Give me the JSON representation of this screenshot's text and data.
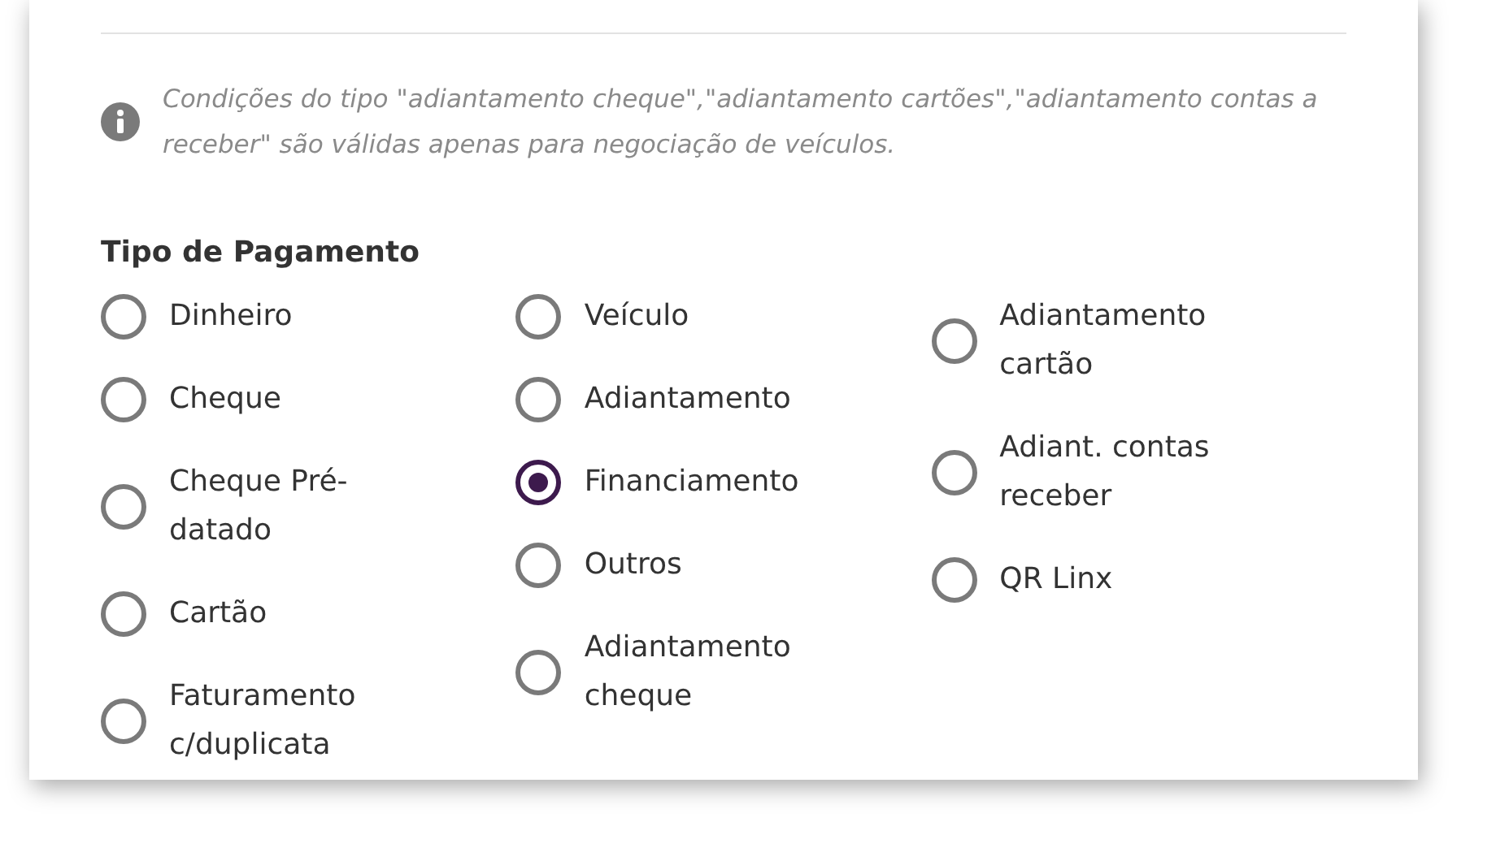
{
  "info": "Condições do tipo \"adiantamento cheque\",\"adiantamento cartões\",\"adiantamento contas a receber\" são válidas apenas para negociação de veículos.",
  "heading": "Tipo de Pagamento",
  "columns": [
    [
      {
        "label": "Dinheiro",
        "selected": false
      },
      {
        "label": "Cheque",
        "selected": false
      },
      {
        "label": "Cheque Pré-datado",
        "selected": false
      },
      {
        "label": "Cartão",
        "selected": false
      },
      {
        "label": "Faturamento c/duplicata",
        "selected": false
      }
    ],
    [
      {
        "label": "Veículo",
        "selected": false
      },
      {
        "label": "Adiantamento",
        "selected": false
      },
      {
        "label": "Financiamento",
        "selected": true
      },
      {
        "label": "Outros",
        "selected": false
      },
      {
        "label": "Adiantamento cheque",
        "selected": false
      }
    ],
    [
      {
        "label": "Adiantamento cartão",
        "selected": false
      },
      {
        "label": "Adiant. contas receber",
        "selected": false
      },
      {
        "label": "QR Linx",
        "selected": false
      }
    ]
  ]
}
